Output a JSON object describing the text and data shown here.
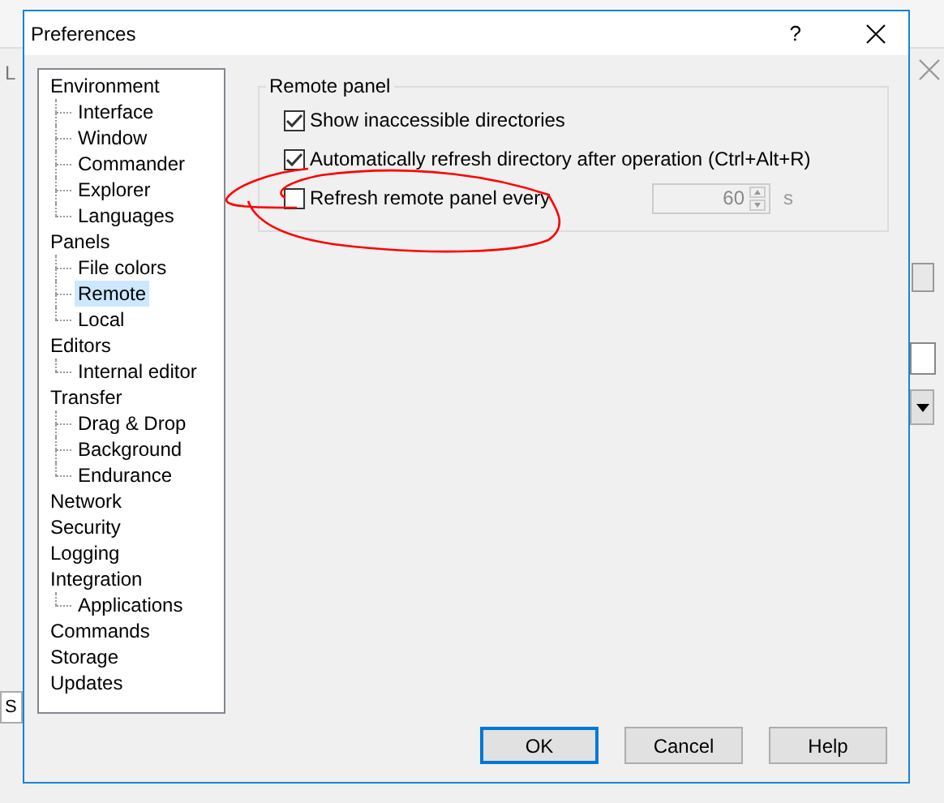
{
  "background_window": {
    "label": "L",
    "tab": "S"
  },
  "dialog": {
    "title": "Preferences",
    "help_glyph": "?"
  },
  "tree": [
    {
      "label": "Environment",
      "selected": false,
      "children": [
        {
          "label": "Interface",
          "selected": false
        },
        {
          "label": "Window",
          "selected": false
        },
        {
          "label": "Commander",
          "selected": false
        },
        {
          "label": "Explorer",
          "selected": false
        },
        {
          "label": "Languages",
          "selected": false
        }
      ]
    },
    {
      "label": "Panels",
      "selected": false,
      "children": [
        {
          "label": "File colors",
          "selected": false
        },
        {
          "label": "Remote",
          "selected": true
        },
        {
          "label": "Local",
          "selected": false
        }
      ]
    },
    {
      "label": "Editors",
      "selected": false,
      "children": [
        {
          "label": "Internal editor",
          "selected": false
        }
      ]
    },
    {
      "label": "Transfer",
      "selected": false,
      "children": [
        {
          "label": "Drag & Drop",
          "selected": false
        },
        {
          "label": "Background",
          "selected": false
        },
        {
          "label": "Endurance",
          "selected": false
        }
      ]
    },
    {
      "label": "Network",
      "selected": false
    },
    {
      "label": "Security",
      "selected": false
    },
    {
      "label": "Logging",
      "selected": false
    },
    {
      "label": "Integration",
      "selected": false,
      "children": [
        {
          "label": "Applications",
          "selected": false
        }
      ]
    },
    {
      "label": "Commands",
      "selected": false
    },
    {
      "label": "Storage",
      "selected": false
    },
    {
      "label": "Updates",
      "selected": false
    }
  ],
  "group": {
    "title": "Remote panel",
    "options": [
      {
        "label": "Show inaccessible directories",
        "checked": true
      },
      {
        "label": "Automatically refresh directory after operation (Ctrl+Alt+R)",
        "checked": true
      },
      {
        "label": "Refresh remote panel every",
        "checked": false
      }
    ],
    "interval": {
      "value": "60",
      "disabled": true,
      "unit": "s"
    }
  },
  "buttons": [
    {
      "label": "OK",
      "default": true
    },
    {
      "label": "Cancel",
      "default": false
    },
    {
      "label": "Help",
      "default": false
    }
  ]
}
